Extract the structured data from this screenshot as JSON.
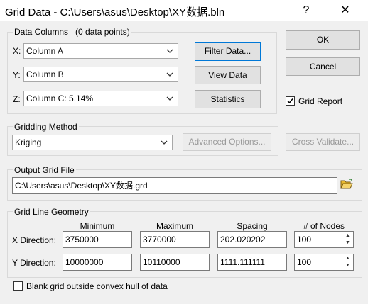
{
  "window": {
    "title": "Grid Data - C:\\Users\\asus\\Desktop\\XY数据.bln",
    "help_symbol": "?",
    "close_symbol": "✕"
  },
  "data_columns": {
    "group_label": "Data Columns",
    "points_label": "(0 data points)",
    "x_label": "X:",
    "x_value": "Column A",
    "y_label": "Y:",
    "y_value": "Column B",
    "z_label": "Z:",
    "z_value": "Column C:  5.14%",
    "filter_button": "Filter Data...",
    "view_button": "View Data",
    "stats_button": "Statistics"
  },
  "right_panel": {
    "ok_button": "OK",
    "cancel_button": "Cancel",
    "grid_report_label": "Grid Report",
    "grid_report_checked": true
  },
  "gridding_method": {
    "group_label": "Gridding Method",
    "method_value": "Kriging",
    "advanced_button": "Advanced Options...",
    "cross_validate_button": "Cross Validate..."
  },
  "output_grid": {
    "group_label": "Output Grid File",
    "path_value": "C:\\Users\\asus\\Desktop\\XY数据.grd"
  },
  "grid_geometry": {
    "group_label": "Grid Line Geometry",
    "col_min": "Minimum",
    "col_max": "Maximum",
    "col_spacing": "Spacing",
    "col_nodes": "# of Nodes",
    "x_label": "X Direction:",
    "x_min": "3750000",
    "x_max": "3770000",
    "x_spacing": "202.020202",
    "x_nodes": "100",
    "y_label": "Y Direction:",
    "y_min": "10000000",
    "y_max": "10110000",
    "y_spacing": "1111.111111",
    "y_nodes": "100"
  },
  "blank_option": {
    "label": "Blank grid outside convex hull of data",
    "checked": false
  },
  "colors": {
    "focus_border": "#0078d7",
    "folder_icon": "#e8b930"
  }
}
